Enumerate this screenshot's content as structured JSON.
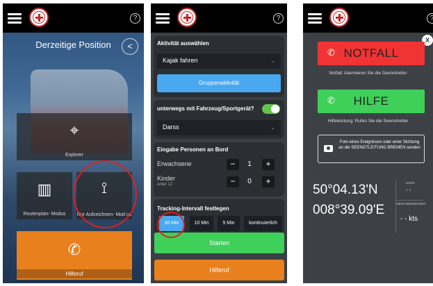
{
  "phone1": {
    "help_icon": "?",
    "title": "Derzeitige Position",
    "tiles": {
      "explorer": "Explorer",
      "routenplan": "Routenplan- Modus",
      "aufzeichnen": "Nur Aufzeichnen- Mod us"
    },
    "hilferuf": "Hilferuf"
  },
  "phone2": {
    "help_icon": "?",
    "aktivitaet": {
      "heading": "Aktivität auswählen",
      "selected": "Kajak fahren",
      "group_button": "Gruppenaktivität"
    },
    "vehicle": {
      "heading": "unterwegs mit Fahrzeug/Sportgerät?",
      "toggle_on": true,
      "selected": "Darss"
    },
    "persons": {
      "heading": "Eingabe Personen an Bord",
      "adults_label": "Erwachsene",
      "adults_value": "1",
      "children_label": "Kinder",
      "children_sub": "unter 12",
      "children_value": "0",
      "minus": "−",
      "plus": "+"
    },
    "tracking": {
      "heading": "Tracking-Intervall festlegen",
      "options": [
        "30 Min",
        "10 Min",
        "5 Min",
        "kontinuierlich"
      ],
      "selected_index": 0
    },
    "start_button": "Starten",
    "hilferuf_button": "Hilferuf"
  },
  "phone3": {
    "help_icon": "?",
    "close": "X",
    "notfall": {
      "label": "NOTFALL",
      "note": "Notfall: Alarmieren Sie die Seenotretter",
      "color": "#f03434"
    },
    "hilfe": {
      "label": "HILFE",
      "note": "Hilfeleistung: Rufen Sie die Seenotretter",
      "color": "#3fd05a"
    },
    "photo_text": "Foto eines Ereignisses oder einer Sichtung an die SEENOTLEITUNG BREMEN senden",
    "latitude": "50°04.13'N",
    "longitude": "008°39.09'E",
    "kurs_label": "KURS",
    "kurs_value": "- -",
    "speed_label": "GESCHWINDIGKEIT",
    "speed_value": "- - kts"
  }
}
